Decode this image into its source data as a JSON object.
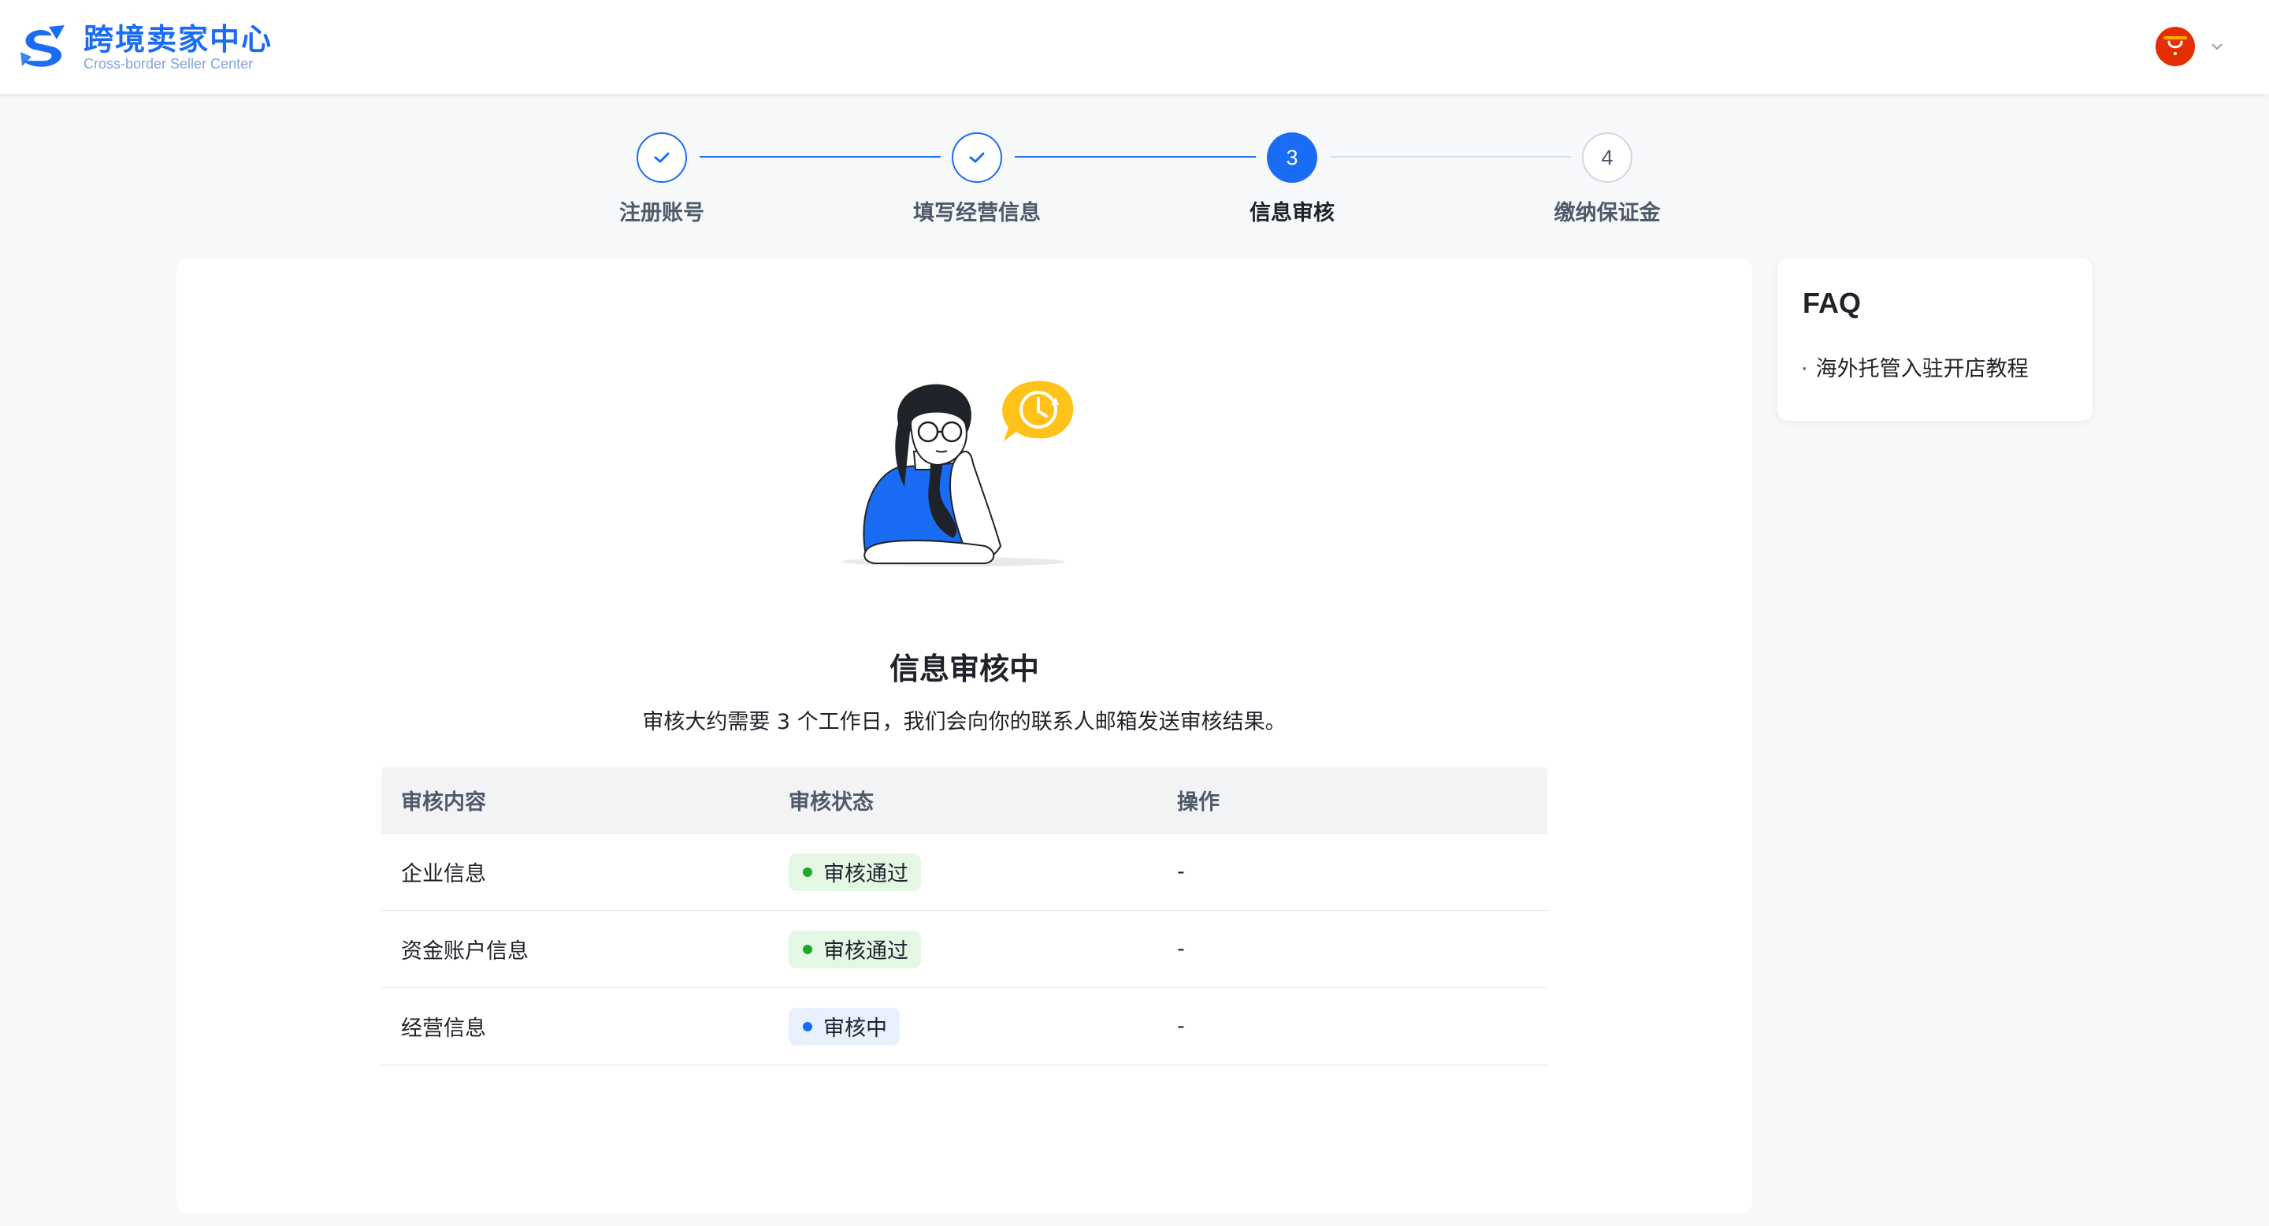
{
  "brand": {
    "title": "跨境卖家中心",
    "subtitle": "Cross-border Seller Center",
    "logo_icon": "seller-center-logo",
    "primary_color": "#1a6cf5"
  },
  "header": {
    "avatar_icon": "aliexpress-bag-avatar",
    "menu_icon": "chevron-down-icon"
  },
  "steps": [
    {
      "number": "1",
      "label": "注册账号",
      "status": "done"
    },
    {
      "number": "2",
      "label": "填写经营信息",
      "status": "done"
    },
    {
      "number": "3",
      "label": "信息审核",
      "status": "active"
    },
    {
      "number": "4",
      "label": "缴纳保证金",
      "status": "pending"
    }
  ],
  "main": {
    "illustration": "person-waiting-with-clock",
    "title": "信息审核中",
    "description": "审核大约需要 3 个工作日，我们会向你的联系人邮箱发送审核结果。"
  },
  "table": {
    "headers": [
      "审核内容",
      "审核状态",
      "操作"
    ],
    "rows": [
      {
        "content": "企业信息",
        "status": "审核通过",
        "status_type": "pass",
        "action": "-"
      },
      {
        "content": "资金账户信息",
        "status": "审核通过",
        "status_type": "pass",
        "action": "-"
      },
      {
        "content": "经营信息",
        "status": "审核中",
        "status_type": "pending",
        "action": "-"
      }
    ],
    "status_colors": {
      "pass": "#1fa82e",
      "pending": "#1a6cf5"
    }
  },
  "faq": {
    "title": "FAQ",
    "items": [
      "海外托管入驻开店教程"
    ],
    "bullet": "·"
  }
}
